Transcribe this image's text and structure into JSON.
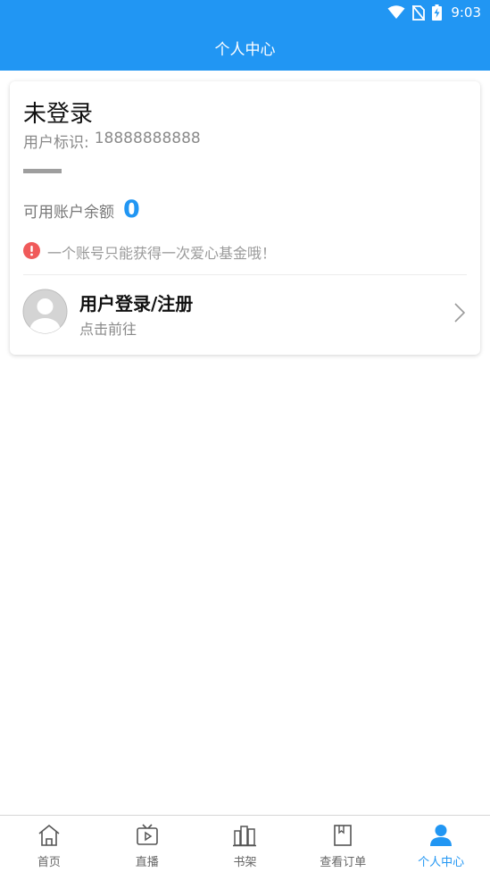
{
  "status_bar": {
    "time": "9:03"
  },
  "header": {
    "title": "个人中心"
  },
  "account": {
    "login_status": "未登录",
    "user_id_label": "用户标识:",
    "user_id_value": "18888888888",
    "balance_label": "可用账户余额",
    "balance_value": "0",
    "notice": "一个账号只能获得一次爱心基金哦！"
  },
  "login_entry": {
    "title": "用户登录/注册",
    "subtitle": "点击前往"
  },
  "bottom_nav": {
    "items": [
      {
        "label": "首页",
        "icon": "home-icon"
      },
      {
        "label": "直播",
        "icon": "tv-icon"
      },
      {
        "label": "书架",
        "icon": "bookshelf-icon"
      },
      {
        "label": "查看订单",
        "icon": "order-icon"
      },
      {
        "label": "个人中心",
        "icon": "person-icon",
        "active": true
      }
    ]
  },
  "colors": {
    "primary": "#2196f3",
    "warning": "#f05a5a",
    "text_secondary": "#8a8a8a"
  }
}
